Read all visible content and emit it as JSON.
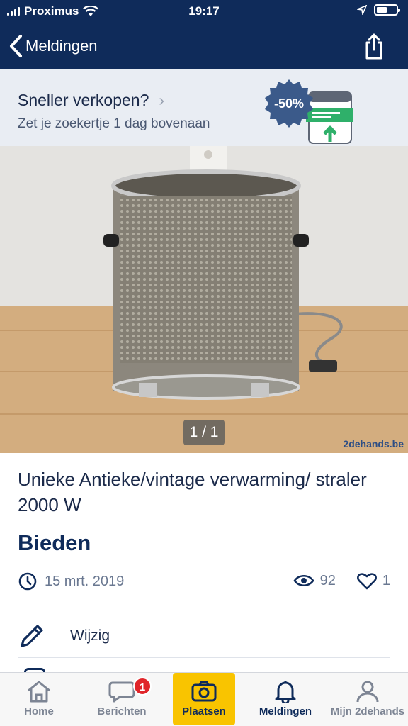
{
  "status_bar": {
    "carrier": "Proximus",
    "time": "19:17"
  },
  "nav": {
    "back_label": "Meldingen"
  },
  "promo": {
    "title": "Sneller verkopen?",
    "subtitle": "Zet je zoekertje 1 dag bovenaan",
    "discount": "-50%"
  },
  "photo": {
    "counter": "1 / 1",
    "watermark": "2dehands.be"
  },
  "ad": {
    "title": "Unieke Antieke/vintage  verwarming/ straler 2000 W",
    "price": "Bieden",
    "date": "15 mrt. 2019",
    "views": "92",
    "favorites": "1",
    "edit_label": "Wijzig"
  },
  "tabbar": {
    "tabs": [
      {
        "label": "Home",
        "icon": "home-icon"
      },
      {
        "label": "Berichten",
        "icon": "chat-icon",
        "badge": "1"
      },
      {
        "label": "Plaatsen",
        "icon": "camera-icon"
      },
      {
        "label": "Meldingen",
        "icon": "bell-icon"
      },
      {
        "label": "Mijn 2dehands",
        "icon": "user-icon"
      }
    ]
  },
  "colors": {
    "brand_navy": "#0f2b5a",
    "accent_yellow": "#f9c400",
    "badge_red": "#e0252a",
    "promo_bg": "#e9edf3"
  }
}
